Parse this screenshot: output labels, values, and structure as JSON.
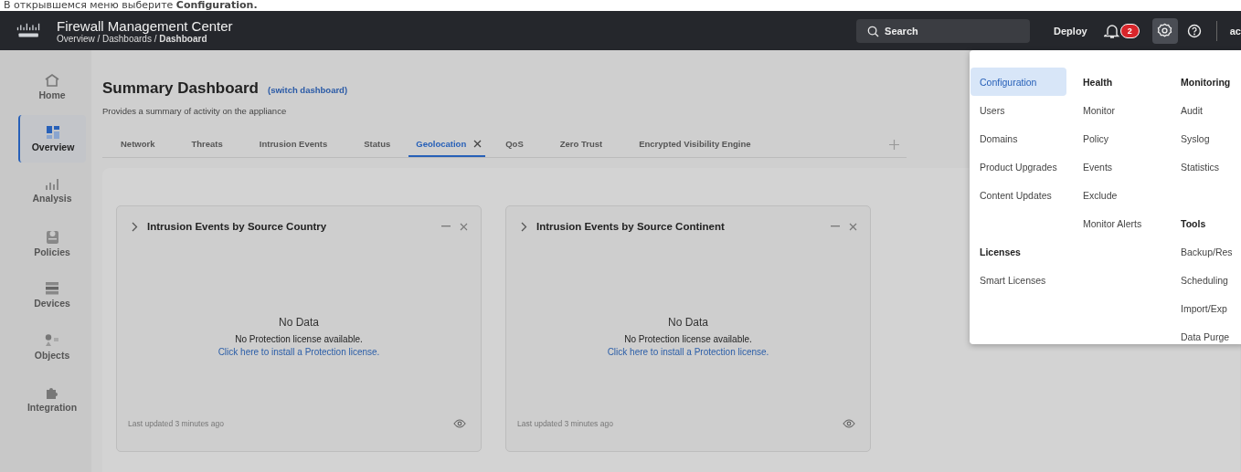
{
  "caption": "В открывшемся меню выберите **Configuration.**",
  "header": {
    "product": "Firewall Management Center",
    "breadcrumb": "Overview / Dashboards / **Dashboard**",
    "search": {
      "placeholder": "Search"
    },
    "deploy": "Deploy",
    "notifications": "2",
    "settings_open": true,
    "user": "ac"
  },
  "sidebar": [
    {
      "label": "Home",
      "kind": "home",
      "selected": false
    },
    {
      "label": "Overview",
      "kind": "overview",
      "selected": true
    },
    {
      "label": "Analysis",
      "kind": "analysis",
      "selected": false
    },
    {
      "label": "Policies",
      "kind": "policies",
      "selected": false
    },
    {
      "label": "Devices",
      "kind": "devices",
      "selected": false
    },
    {
      "label": "Objects",
      "kind": "objects",
      "selected": false
    },
    {
      "label": "Integration",
      "kind": "integration",
      "selected": false
    }
  ],
  "page": {
    "title": "Summary Dashboard",
    "switch_link": "(switch dashboard)",
    "subtitle": "Provides a summary of activity on the appliance"
  },
  "tabs": [
    {
      "label": "Network",
      "selected": false
    },
    {
      "label": "Threats",
      "selected": false
    },
    {
      "label": "Intrusion Events",
      "selected": false
    },
    {
      "label": "Status",
      "selected": false
    },
    {
      "label": "Geolocation",
      "selected": true
    },
    {
      "label": "QoS",
      "selected": false
    },
    {
      "label": "Zero Trust",
      "selected": false
    },
    {
      "label": "Encrypted Visibility Engine",
      "selected": false
    }
  ],
  "widgets": [
    {
      "title": "Intrusion Events by Source Country",
      "empty_title": "No Data",
      "message": "No Protection license available.",
      "link": "Click here to install a Protection license.",
      "updated": "Last updated 3 minutes ago"
    },
    {
      "title": "Intrusion Events by Source Continent",
      "empty_title": "No Data",
      "message": "No Protection license available.",
      "link": "Click here to install a Protection license.",
      "updated": "Last updated 3 minutes ago"
    }
  ],
  "settings_menu": [
    [
      {
        "items": [
          {
            "label": "Configuration",
            "selected": true
          },
          {
            "label": "Users",
            "selected": false
          },
          {
            "label": "Domains",
            "selected": false
          },
          {
            "label": "Product Upgrades",
            "selected": false
          },
          {
            "label": "Content Updates",
            "selected": false
          }
        ]
      },
      {
        "title": "Licenses",
        "items": [
          {
            "label": "Smart Licenses",
            "selected": false
          }
        ]
      }
    ],
    [
      {
        "title": "Health",
        "items": [
          {
            "label": "Monitor",
            "selected": false
          },
          {
            "label": "Policy",
            "selected": false
          },
          {
            "label": "Events",
            "selected": false
          },
          {
            "label": "Exclude",
            "selected": false
          },
          {
            "label": "Monitor Alerts",
            "selected": false
          }
        ]
      }
    ],
    [
      {
        "title": "Monitoring",
        "items": [
          {
            "label": "Audit",
            "selected": false
          },
          {
            "label": "Syslog",
            "selected": false
          },
          {
            "label": "Statistics",
            "selected": false
          }
        ]
      },
      {
        "title": "Tools",
        "items": [
          {
            "label": "Backup/Res",
            "selected": false
          },
          {
            "label": "Scheduling",
            "selected": false
          },
          {
            "label": "Import/Exp",
            "selected": false
          },
          {
            "label": "Data Purge",
            "selected": false
          }
        ]
      }
    ]
  ]
}
